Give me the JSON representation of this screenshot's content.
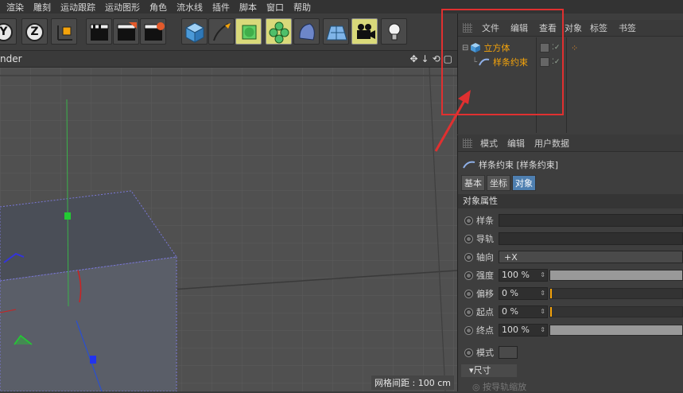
{
  "menubar": [
    "渲染",
    "雕刻",
    "运动跟踪",
    "运动图形",
    "角色",
    "流水线",
    "插件",
    "脚本",
    "窗口",
    "帮助"
  ],
  "toolbar": {
    "axis_y": "Y",
    "axis_z": "Z"
  },
  "viewport": {
    "title": "nder",
    "grid_spacing": "网格间距 : 100 cm"
  },
  "object_manager": {
    "menu": [
      "文件",
      "编辑",
      "查看",
      "对象",
      "标签",
      "书签"
    ],
    "objects": [
      {
        "name": "立方体",
        "icon": "cube-icon"
      },
      {
        "name": "样条约束",
        "icon": "spline-constraint-icon"
      }
    ]
  },
  "attribute_manager": {
    "menu": [
      "模式",
      "编辑",
      "用户数据"
    ],
    "title": "样条约束 [样条约束]",
    "tabs": [
      "基本",
      "坐标",
      "对象"
    ],
    "active_tab": "对象",
    "section": "对象属性",
    "params": {
      "spline": {
        "label": "样条",
        "value": ""
      },
      "rail": {
        "label": "导轨",
        "value": ""
      },
      "axis": {
        "label": "轴向",
        "value": "+X"
      },
      "strength": {
        "label": "强度",
        "value": "100 %",
        "fraction": 1.0
      },
      "offset": {
        "label": "偏移",
        "value": "0 %",
        "fraction": 0.0
      },
      "start": {
        "label": "起点",
        "value": "0 %",
        "fraction": 0.0
      },
      "end": {
        "label": "终点",
        "value": "100 %",
        "fraction": 1.0
      },
      "mode": {
        "label": "模式",
        "value": ""
      }
    },
    "subsection": "尺寸",
    "rail_scale": "按导轨缩放"
  },
  "colors": {
    "accent_orange": "#f4a30b",
    "highlight_box": "#e03030",
    "active_tab": "#4e7fb0"
  }
}
